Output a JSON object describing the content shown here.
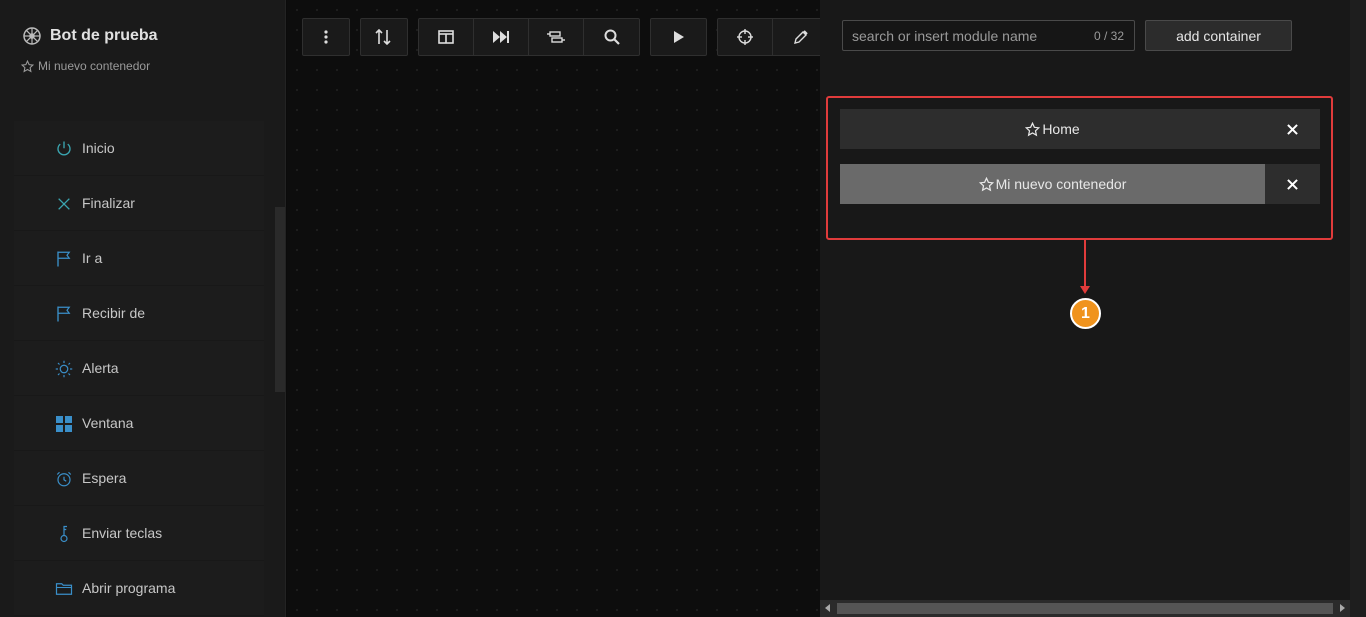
{
  "sidebar": {
    "title": "Bot de prueba",
    "subtitle": "Mi nuevo contenedor",
    "items": [
      {
        "label": "Inicio",
        "icon": "power-icon"
      },
      {
        "label": "Finalizar",
        "icon": "close-x-icon"
      },
      {
        "label": "Ir a",
        "icon": "flag-icon"
      },
      {
        "label": "Recibir de",
        "icon": "flag-icon"
      },
      {
        "label": "Alerta",
        "icon": "sun-icon"
      },
      {
        "label": "Ventana",
        "icon": "window-grid-icon"
      },
      {
        "label": "Espera",
        "icon": "alarm-clock-icon"
      },
      {
        "label": "Enviar teclas",
        "icon": "key-icon"
      },
      {
        "label": "Abrir programa",
        "icon": "folder-icon"
      }
    ]
  },
  "toolbar": {
    "buttons": [
      "menu-dots-icon",
      "sort-icon",
      "split-view-icon",
      "fast-forward-icon",
      "layout-icon",
      "search-icon",
      "play-icon",
      "crosshair-icon",
      "eyedropper-icon"
    ]
  },
  "panel": {
    "search_placeholder": "search or insert module name",
    "search_count": "0 / 32",
    "add_label": "add container",
    "containers": [
      {
        "label": "Home"
      },
      {
        "label": "Mi nuevo contenedor"
      }
    ],
    "badge": "1"
  },
  "colors": {
    "accent_teal": "#3aa5b0",
    "highlight_red": "#e03b3b",
    "badge_orange": "#f0931d"
  }
}
